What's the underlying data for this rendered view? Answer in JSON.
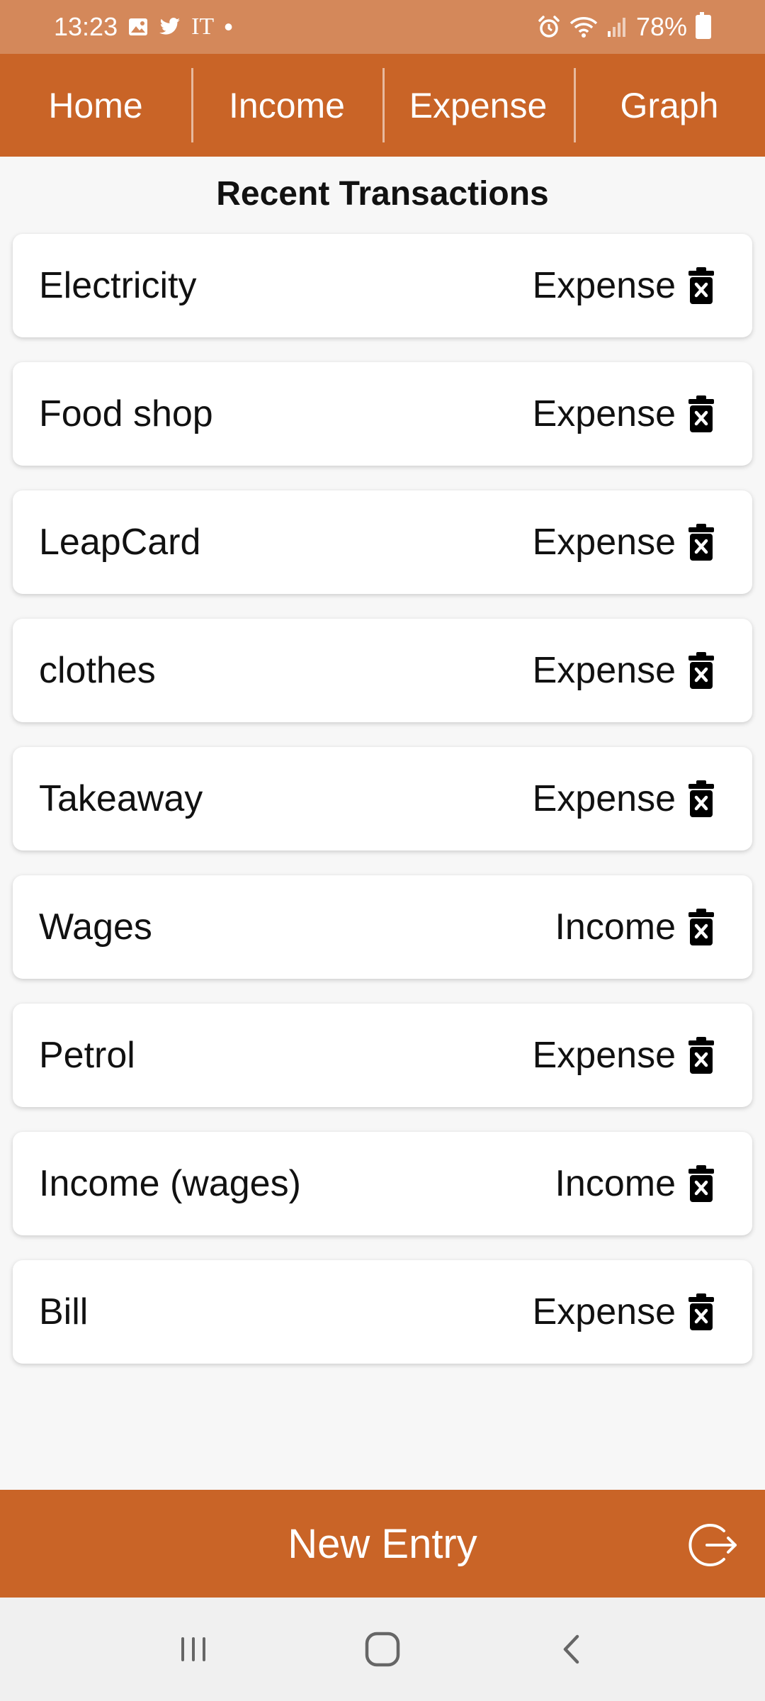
{
  "status_bar": {
    "time": "13:23",
    "carrier_text": "IT",
    "dot": "•",
    "battery": "78%",
    "icons_left": [
      "image-icon",
      "twitter-icon"
    ],
    "icons_right": [
      "alarm-icon",
      "wifi-icon",
      "signal-icon",
      "battery-icon"
    ]
  },
  "tabs": [
    "Home",
    "Income",
    "Expense",
    "Graph"
  ],
  "heading": "Recent Transactions",
  "transactions": [
    {
      "title": "Electricity",
      "type": "Expense"
    },
    {
      "title": "Food shop",
      "type": "Expense"
    },
    {
      "title": "LeapCard",
      "type": "Expense"
    },
    {
      "title": "clothes",
      "type": "Expense"
    },
    {
      "title": "Takeaway",
      "type": "Expense"
    },
    {
      "title": "Wages",
      "type": "Income"
    },
    {
      "title": "Petrol",
      "type": "Expense"
    },
    {
      "title": "Income (wages)",
      "type": "Income"
    },
    {
      "title": "Bill",
      "type": "Expense"
    }
  ],
  "bottom_bar": {
    "label": "New Entry",
    "icon": "logout-icon"
  },
  "nav_bar": {
    "icons": [
      "recent-apps-icon",
      "home-icon",
      "back-icon"
    ]
  },
  "colors": {
    "primary": "#c96427",
    "status_bar": "#d4885a",
    "background": "#f7f7f7",
    "card": "#ffffff",
    "text": "#111111"
  }
}
